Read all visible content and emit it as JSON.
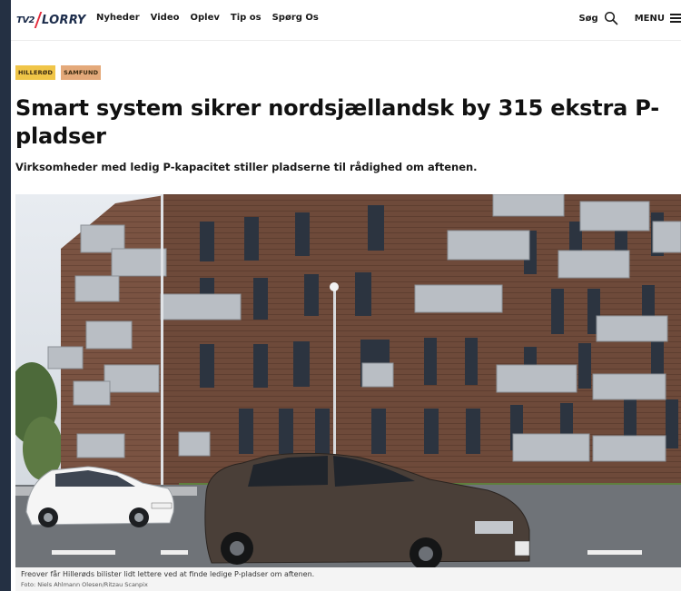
{
  "header": {
    "logo_tv2": "TV2",
    "logo_name": "LORRY",
    "nav": [
      "Nyheder",
      "Video",
      "Oplev",
      "Tip os",
      "Spørg Os"
    ],
    "search_label": "Søg",
    "menu_label": "MENU"
  },
  "article": {
    "tags": [
      "HILLERØD",
      "SAMFUND"
    ],
    "title": "Smart system sikrer nordsjællandsk by 315 ekstra P-pladser",
    "subtitle": "Virksomheder med ledig P-kapacitet stiller pladserne til rådighed om aftenen.",
    "caption": "Freover får Hillerøds bilister lidt lettere ved at finde ledige P-pladser om aftenen.",
    "credit": "Foto: Niels Ahlmann Olesen/Ritzau Scanpix"
  },
  "colors": {
    "brand_red": "#e32b3b",
    "brand_navy": "#1b2b4a",
    "tag_location": "#f0c548",
    "tag_category": "#e4a97a",
    "outer_background": "#243043"
  }
}
